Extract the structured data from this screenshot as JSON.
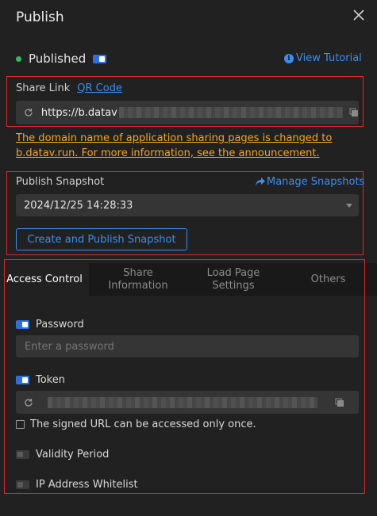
{
  "header": {
    "title": "Publish",
    "close_icon": "close-icon"
  },
  "status": {
    "label": "Published",
    "dot_color": "#2ebd63",
    "toggle_on": true,
    "tutorial_link": "View Tutorial"
  },
  "share_link": {
    "label": "Share Link",
    "qr_link": "QR Code",
    "url_prefix": "https://b.datav"
  },
  "notice": "The domain name of application sharing pages is changed to b.datav.run. For more information, see the announcement.",
  "snapshot": {
    "label": "Publish Snapshot",
    "manage_link": "Manage Snapshots",
    "selected": "2024/12/25 14:28:33",
    "create_button": "Create and Publish Snapshot"
  },
  "tabs": [
    {
      "label": "Access Control",
      "active": true
    },
    {
      "label": "Share Information",
      "active": false
    },
    {
      "label": "Load Page Settings",
      "active": false
    },
    {
      "label": "Others",
      "active": false
    }
  ],
  "access": {
    "password_label": "Password",
    "password_placeholder": "Enter a password",
    "token_label": "Token",
    "once_label": "The signed URL can be accessed only once.",
    "validity_label": "Validity Period",
    "ip_label": "IP Address Whitelist"
  },
  "colors": {
    "accent": "#3a8ff0",
    "toggle": "#2f6fe4",
    "warning": "#f5a623",
    "highlight_box": "#e0282e"
  }
}
